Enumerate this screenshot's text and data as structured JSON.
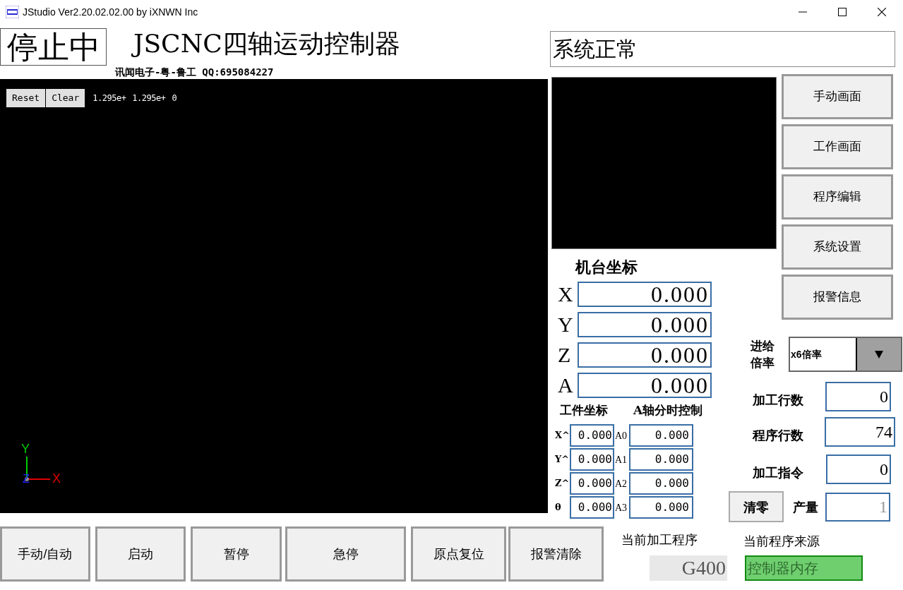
{
  "window": {
    "title": "JStudio Ver2.20.02.02.00 by iXNWN Inc"
  },
  "run_state": "停止中",
  "app_title": "JSCNC四轴运动控制器",
  "subtitle": "讯闻电子-粤-鲁工 QQ:695084227",
  "canvas": {
    "buttons": [
      "Reset",
      "Clear"
    ],
    "readouts": [
      "1.295e+",
      "1.295e+",
      "0"
    ],
    "axis_labels": {
      "x": "X",
      "y": "Y",
      "z": "Z"
    }
  },
  "system_status": "系统正常",
  "nav_buttons": [
    "手动画面",
    "工作画面",
    "程序编辑",
    "系统设置",
    "报警信息"
  ],
  "machine_coords": {
    "title": "机台坐标",
    "rows": [
      {
        "axis": "X",
        "value": "0.000"
      },
      {
        "axis": "Y",
        "value": "0.000"
      },
      {
        "axis": "Z",
        "value": "0.000"
      },
      {
        "axis": "A",
        "value": "0.000"
      }
    ]
  },
  "work_coords": {
    "title": "工件坐标",
    "rows": [
      {
        "label": "X^",
        "value": "0.000"
      },
      {
        "label": "Y^",
        "value": "0.000"
      },
      {
        "label": "Z^",
        "value": "0.000"
      },
      {
        "label": "θ",
        "value": "0.000"
      }
    ]
  },
  "a_axis_control": {
    "title": "A轴分时控制",
    "rows": [
      {
        "label": "A0",
        "value": "0.000"
      },
      {
        "label": "A1",
        "value": "0.000"
      },
      {
        "label": "A2",
        "value": "0.000"
      },
      {
        "label": "A3",
        "value": "0.000"
      }
    ]
  },
  "feed_rate": {
    "label": "进给倍率",
    "value": "x6倍率"
  },
  "counters": [
    {
      "label": "加工行数",
      "value": "0"
    },
    {
      "label": "程序行数",
      "value": "74"
    },
    {
      "label": "加工指令",
      "value": "0"
    }
  ],
  "clear_button": "清零",
  "output": {
    "label": "产量",
    "value": "1",
    "disabled": true
  },
  "bottom_buttons": [
    "手动/自动",
    "启动",
    "暂停",
    "急停",
    "原点复位",
    "报警清除"
  ],
  "current_program": {
    "label": "当前加工程序",
    "value": "G400"
  },
  "program_source": {
    "label": "当前程序来源",
    "value": "控制器内存"
  }
}
